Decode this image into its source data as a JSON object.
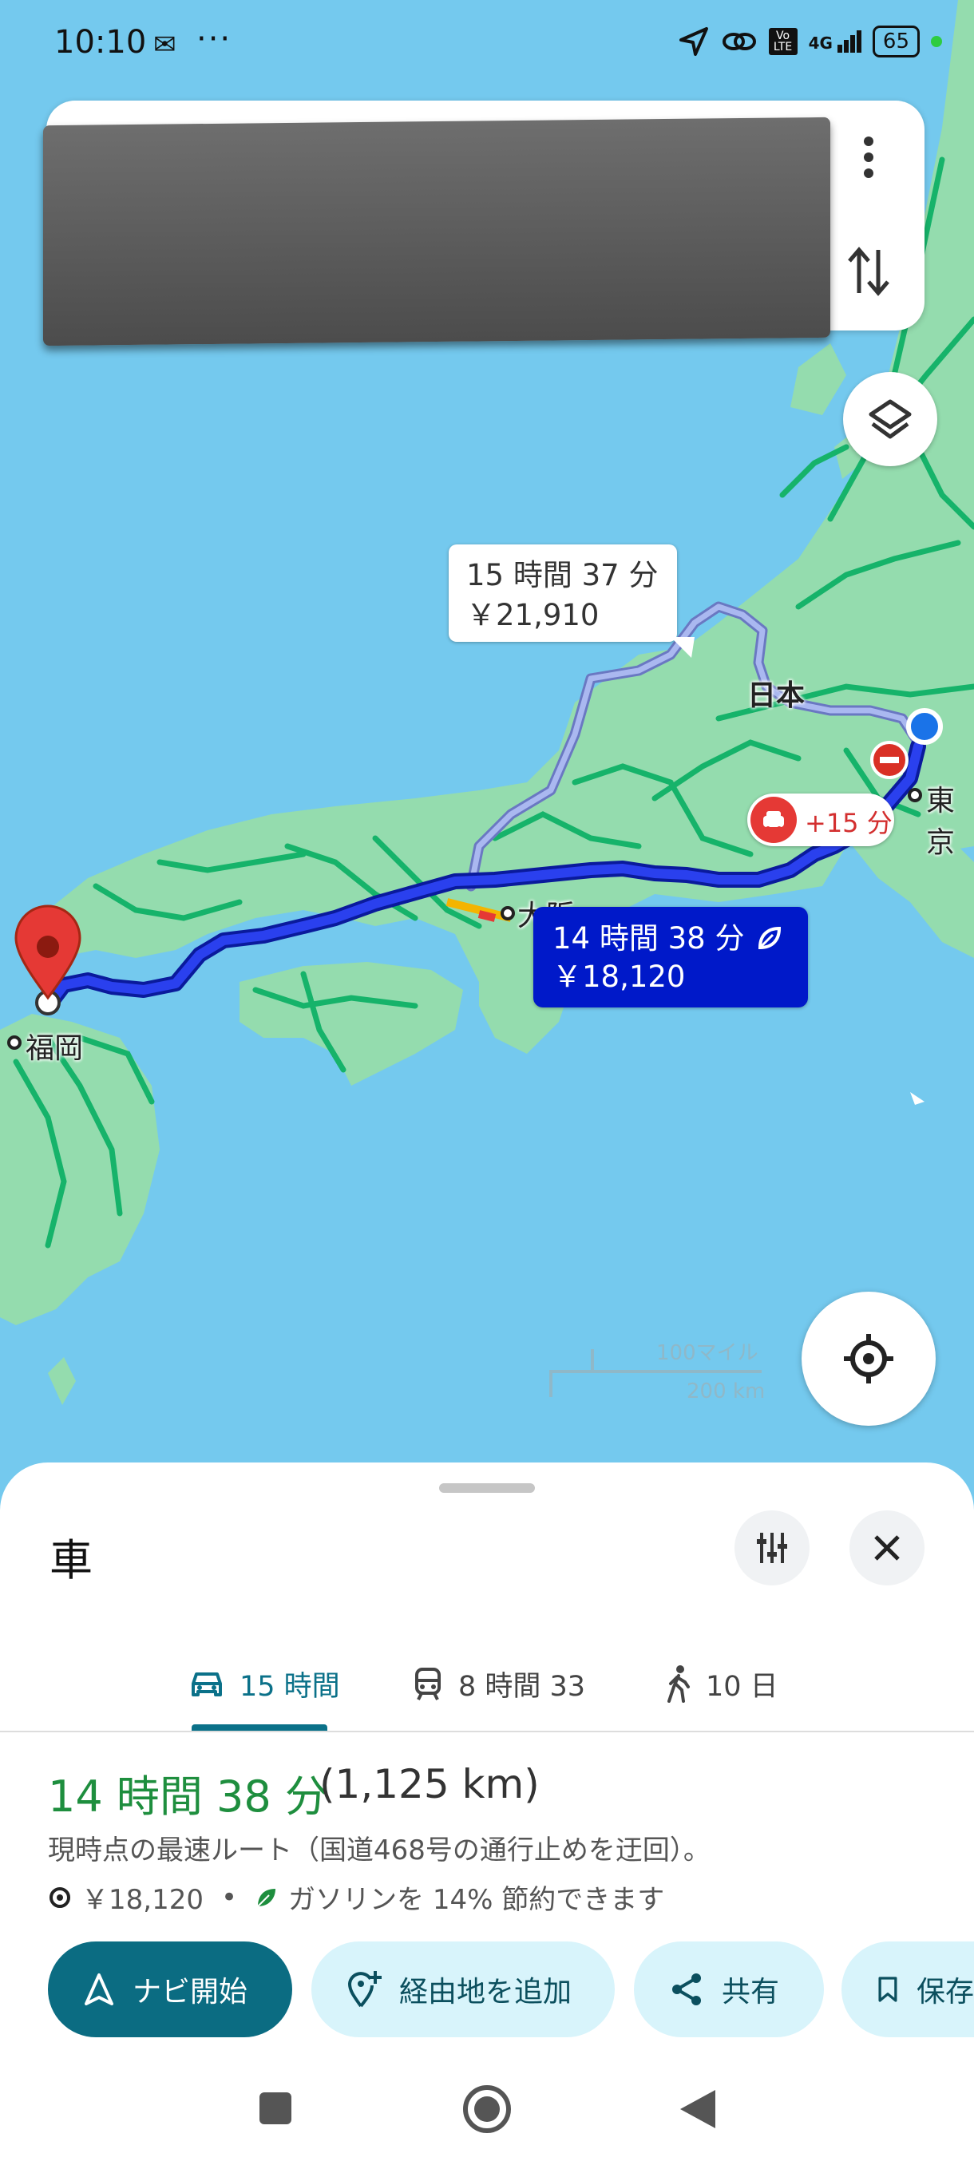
{
  "status_bar": {
    "time": "10:10",
    "battery": "65",
    "network": "4G",
    "volte": "Vo LTE"
  },
  "map": {
    "alt_route": {
      "time": "15 時間 37 分",
      "toll": "￥21,910"
    },
    "main_route": {
      "time": "14 時間 38 分",
      "toll": "￥18,120"
    },
    "traffic_delay": "+15 分",
    "labels": {
      "japan": "日本",
      "osaka": "大阪",
      "tokyo": "東京",
      "fukuoka": "福岡"
    },
    "scale": {
      "miles": "100マイル",
      "km": "200 km"
    }
  },
  "sheet": {
    "mode_title": "車",
    "tabs": [
      {
        "label": "15 時間",
        "icon": "car-icon",
        "active": true
      },
      {
        "label": "8 時間 33",
        "icon": "train-icon",
        "active": false
      },
      {
        "label": "10 日",
        "icon": "walk-icon",
        "active": false
      }
    ],
    "route": {
      "time": "14 時間 38 分",
      "distance": "(1,125 km)",
      "description": "現時点の最速ルート（国道468号の通行止めを迂回）。",
      "toll": "￥18,120",
      "separator": "•",
      "eco": "ガソリンを 14% 節約できます"
    },
    "buttons": {
      "start": "ナビ開始",
      "add_stop": "経由地を追加",
      "share": "共有",
      "save": "保存"
    }
  },
  "colors": {
    "sea": "#74c9ee",
    "land": "#94dcae",
    "route_main": "#1a2fd6",
    "route_alt": "#8a9ce6",
    "accent": "#0b6c82",
    "green_text": "#1e8e3e"
  }
}
